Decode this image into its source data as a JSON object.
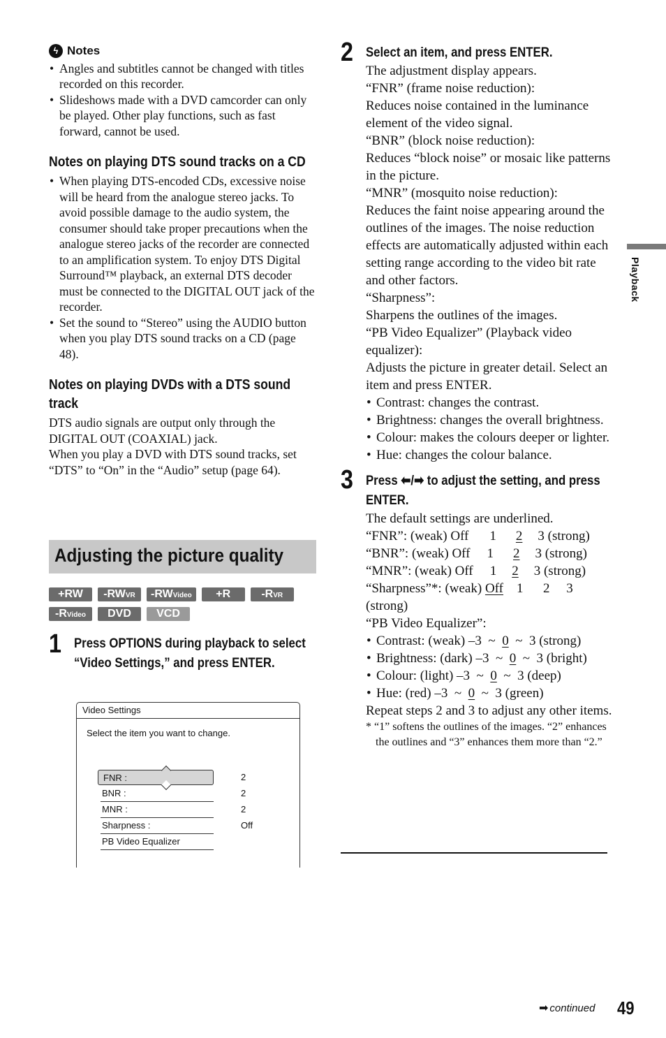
{
  "notes": {
    "heading": "Notes",
    "icon": "notes-icon",
    "items": [
      "Angles and subtitles cannot be changed with titles recorded on this recorder.",
      "Slideshows made with a DVD camcorder can only be played. Other play functions, such as fast forward, cannot be used."
    ]
  },
  "dts_cd": {
    "heading": "Notes on playing DTS sound tracks on a CD",
    "items": [
      "When playing DTS-encoded CDs, excessive noise will be heard from the analogue stereo jacks. To avoid possible damage to the audio system, the consumer should take proper precautions when the analogue stereo jacks of the recorder are connected to an amplification system. To enjoy DTS Digital Surround™ playback, an external DTS decoder must be connected to the DIGITAL OUT jack of the recorder.",
      "Set the sound to “Stereo” using the AUDIO button when you play DTS sound tracks on a CD (page 48)."
    ]
  },
  "dts_dvd": {
    "heading": "Notes on playing DVDs with a DTS sound track",
    "paragraphs": [
      "DTS audio signals are output only through the DIGITAL OUT (COAXIAL) jack.",
      "When you play a DVD with DTS sound tracks, set “DTS” to “On” in the “Audio” setup (page 64)."
    ]
  },
  "section": {
    "title": "Adjusting the picture quality",
    "badges_row1": [
      {
        "main": "+RW",
        "sub": ""
      },
      {
        "main": "-RW",
        "sub": "VR"
      },
      {
        "main": "-RW",
        "sub": "Video"
      },
      {
        "main": "+R",
        "sub": ""
      },
      {
        "main": "-R",
        "sub": "VR"
      }
    ],
    "badges_row2": [
      {
        "main": "-R",
        "sub": "Video"
      },
      {
        "main": "DVD",
        "sub": ""
      },
      {
        "main": "VCD",
        "sub": ""
      }
    ]
  },
  "step1": {
    "number": "1",
    "title": "Press OPTIONS during playback to select “Video Settings,” and press ENTER."
  },
  "screen": {
    "title": "Video Settings",
    "prompt": "Select the item you want to change.",
    "rows": [
      {
        "label": "FNR :",
        "value": "2"
      },
      {
        "label": "BNR :",
        "value": "2"
      },
      {
        "label": "MNR :",
        "value": "2"
      },
      {
        "label": "Sharpness :",
        "value": "Off"
      },
      {
        "label": "PB Video Equalizer",
        "value": ""
      }
    ]
  },
  "step2": {
    "number": "2",
    "title": "Select an item, and press ENTER.",
    "lines": [
      "The adjustment display appears.",
      "“FNR” (frame noise reduction):",
      "Reduces noise contained in the luminance element of the video signal.",
      "“BNR” (block noise reduction):",
      "Reduces “block noise” or mosaic like patterns in the picture.",
      "“MNR” (mosquito noise reduction):",
      "Reduces the faint noise appearing around the outlines of the images. The noise reduction effects are automatically adjusted within each setting range according to the video bit rate and other factors.",
      "“Sharpness”:",
      "Sharpens the outlines of the images.",
      "“PB Video Equalizer” (Playback video equalizer):",
      "Adjusts the picture in greater detail. Select an item and press ENTER."
    ],
    "bullets": [
      "Contrast: changes the contrast.",
      "Brightness: changes the overall brightness.",
      "Colour: makes the colours deeper or lighter.",
      "Hue: changes the colour balance."
    ]
  },
  "step3": {
    "number": "3",
    "title_pre": "Press ",
    "title_arrows": "⬅/➡",
    "title_post": " to adjust the setting, and press ENTER.",
    "intro": "The default settings are underlined.",
    "settings": [
      {
        "name": "“FNR”: (weak) Off",
        "v1": "1",
        "v2": "2",
        "v3": "3 (strong)",
        "default": "2"
      },
      {
        "name": "“BNR”: (weak) Off",
        "v1": "1",
        "v2": "2",
        "v3": "3 (strong)",
        "default": "2"
      },
      {
        "name": "“MNR”: (weak) Off",
        "v1": "1",
        "v2": "2",
        "v3": "3 (strong)",
        "default": "2"
      }
    ],
    "sharpness": {
      "pre": "“Sharpness”*: (weak) ",
      "default": "Off",
      "rest": "    1      2     3",
      "end": "(strong)"
    },
    "eq_label": "“PB Video Equalizer”:",
    "eq": [
      {
        "pre": "Contrast: (weak) –3  ~  ",
        "default": "0",
        "post": "  ~  3 (strong)"
      },
      {
        "pre": "Brightness: (dark) –3  ~  ",
        "default": "0",
        "post": "  ~  3 (bright)"
      },
      {
        "pre": "Colour: (light) –3  ~  ",
        "default": "0",
        "post": "  ~  3 (deep)"
      },
      {
        "pre": "Hue: (red) –3  ~  ",
        "default": "0",
        "post": "  ~  3 (green)"
      }
    ],
    "repeat": "Repeat steps 2 and 3 to adjust any other items.",
    "footnote": "* “1” softens the outlines of the images. “2” enhances the outlines and “3” enhances them more than “2.”"
  },
  "side_tab": "Playback",
  "footer": {
    "continued": "continued",
    "page": "49"
  }
}
